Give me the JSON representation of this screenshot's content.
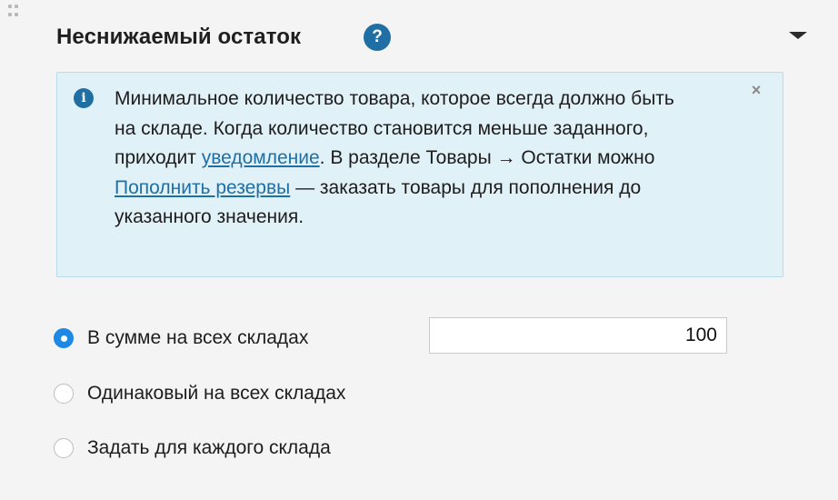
{
  "header": {
    "title": "Неснижаемый остаток",
    "help_icon": "question-circle-icon",
    "help_label": "?",
    "collapse_icon": "caret-down-icon"
  },
  "info": {
    "icon": "info-circle-icon",
    "icon_label": "i",
    "close_icon": "close-icon",
    "close_label": "×",
    "text_part1": "Минимальное количество товара, которое всегда должно быть на складе. Когда количество становится меньше заданного, приходит ",
    "link1": "уведомление",
    "text_part2": ". В разделе Товары → Остатки можно ",
    "link2": "Пополнить резервы",
    "text_part3": " — заказать товары для пополнения до указанного значения."
  },
  "options": [
    {
      "label": "В сумме на всех складах",
      "selected": true
    },
    {
      "label": "Одинаковый на всех складах",
      "selected": false
    },
    {
      "label": "Задать для каждого склада",
      "selected": false
    }
  ],
  "amount": {
    "value": "100"
  },
  "colors": {
    "accent": "#1e88e5",
    "link": "#1f6fa5",
    "info_background": "#e1f1f8",
    "info_border": "#b9dbeb",
    "page_background": "#f4f4f4"
  }
}
